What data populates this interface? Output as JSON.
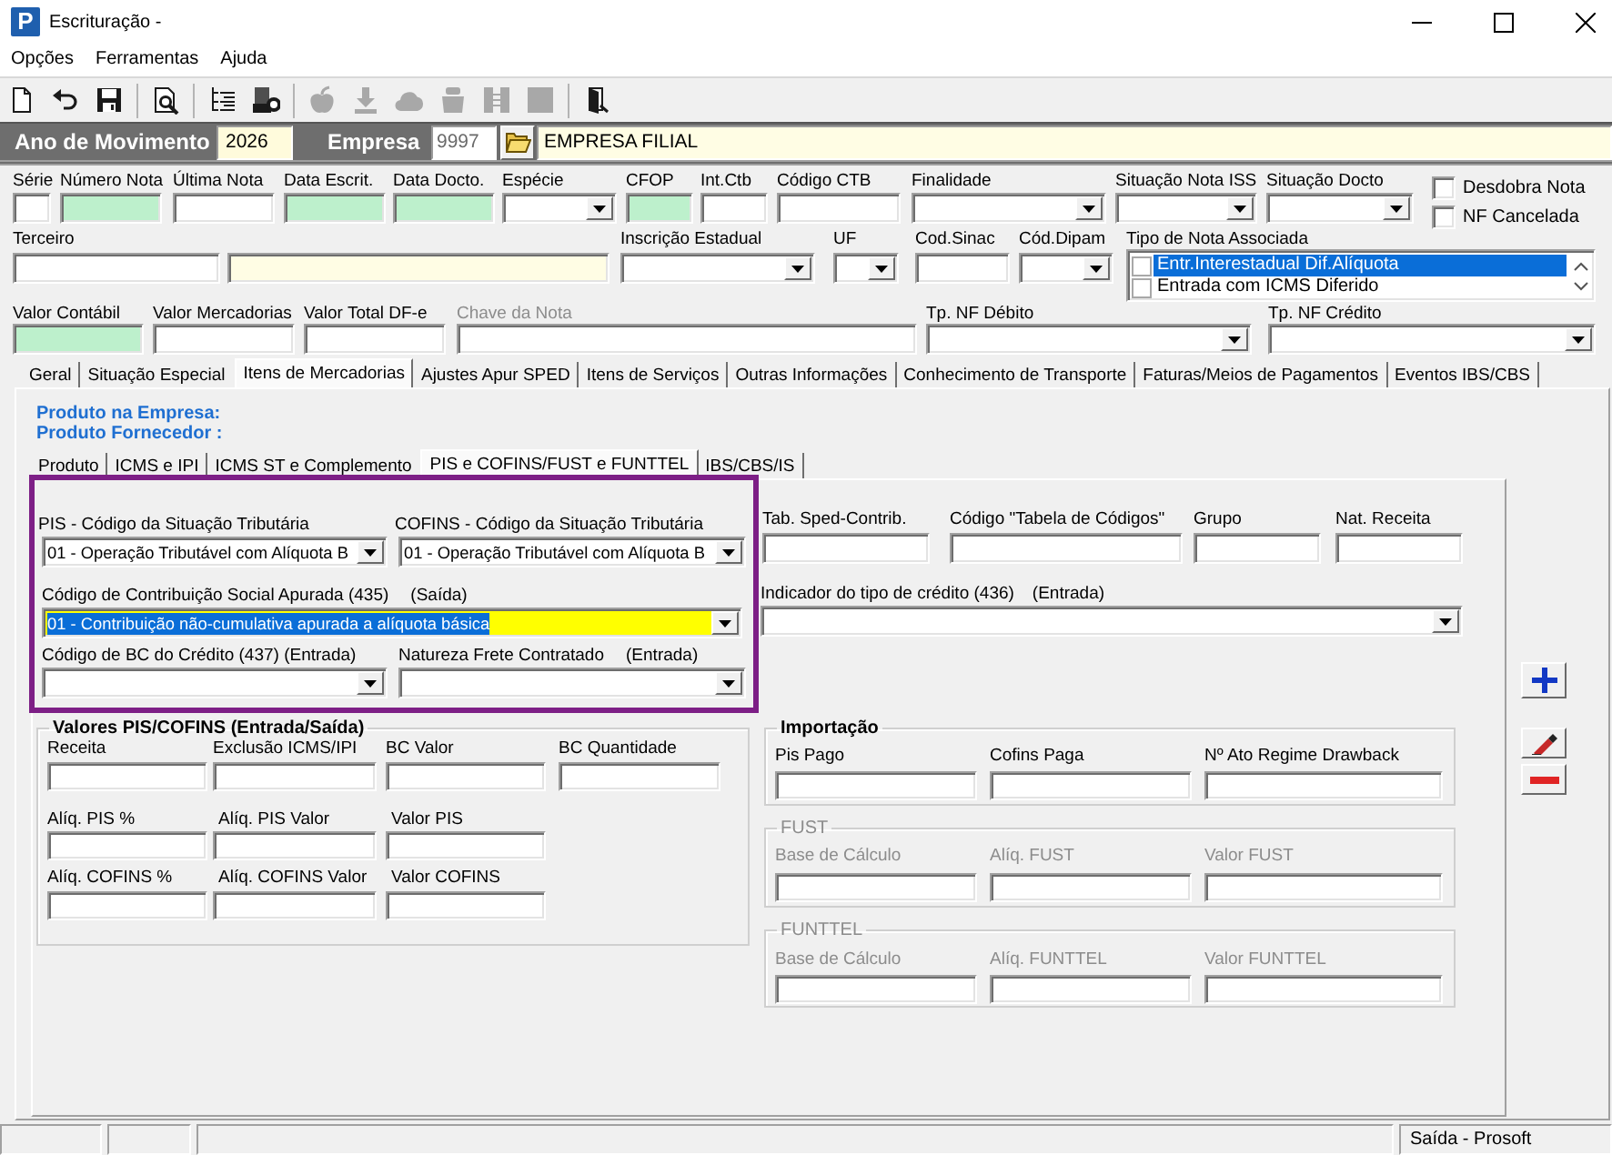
{
  "window": {
    "logo": "P",
    "title": "Escrituração -"
  },
  "menu": [
    {
      "label": "Opções"
    },
    {
      "label": "Ferramentas"
    },
    {
      "label": "Ajuda"
    }
  ],
  "toolbar": [
    {
      "items": [
        {
          "disabled": false
        },
        {
          "disabled": false
        },
        {
          "disabled": false
        }
      ]
    },
    {
      "items": [
        {
          "disabled": false
        }
      ]
    },
    {
      "items": [
        {
          "disabled": false
        },
        {
          "disabled": false
        }
      ]
    },
    {
      "items": [
        {
          "disabled": true
        },
        {
          "disabled": true
        },
        {
          "disabled": true
        },
        {
          "disabled": true
        },
        {
          "disabled": true
        },
        {
          "disabled": true
        }
      ]
    },
    {
      "items": [
        {
          "disabled": false
        }
      ]
    }
  ],
  "header": {
    "year_label": "Ano de Movimento",
    "year": "2026",
    "company_label": "Empresa",
    "company_code": "9997",
    "company_name": "EMPRESA FILIAL"
  },
  "form": {
    "row_1": [
      {
        "label": "Série",
        "kind": "text",
        "highlighted": false
      },
      {
        "label": "Número Nota",
        "kind": "text",
        "highlighted": true
      },
      {
        "label": "Última Nota",
        "kind": "text",
        "highlighted": false
      },
      {
        "label": "Data Escrit.",
        "kind": "text",
        "highlighted": true
      },
      {
        "label": "Data Docto.",
        "kind": "text",
        "highlighted": true
      },
      {
        "label": "Espécie",
        "kind": "select",
        "highlighted": false
      },
      {
        "label": "CFOP",
        "kind": "text",
        "highlighted": true
      },
      {
        "label": "Int.Ctb",
        "kind": "text",
        "highlighted": false
      },
      {
        "label": "Código CTB",
        "kind": "text",
        "highlighted": false
      },
      {
        "label": "Finalidade",
        "kind": "select",
        "highlighted": false
      },
      {
        "label": "Situação Nota ISS",
        "kind": "select",
        "highlighted": false
      },
      {
        "label": "Situação Docto",
        "kind": "select",
        "highlighted": false
      }
    ],
    "options": [
      {
        "label": "Desdobra Nota",
        "checked": false
      },
      {
        "label": "NF Cancelada",
        "checked": false
      }
    ],
    "row_2": [
      {
        "label": "Terceiro",
        "kind": "text"
      },
      {
        "kind": "display"
      },
      {
        "label": "Inscrição Estadual",
        "kind": "select"
      },
      {
        "label": "UF",
        "kind": "select"
      },
      {
        "label": "Cod.Sinac",
        "kind": "text"
      },
      {
        "label": "Cód.Dipam",
        "kind": "select"
      },
      {
        "label": "Tipo de Nota Associada",
        "kind": "checklist",
        "items": [
          {
            "label": "Entr.Interestadual Dif.Alíquota",
            "checked": false,
            "selected": true
          },
          {
            "label": "Entrada com ICMS Diferido",
            "checked": false,
            "selected": false
          }
        ]
      }
    ],
    "row_3": [
      {
        "label": "Valor Contábil",
        "kind": "text",
        "highlighted": true,
        "disabled": false
      },
      {
        "label": "Valor Mercadorias",
        "kind": "text",
        "highlighted": false,
        "disabled": false
      },
      {
        "label": "Valor Total DF-e",
        "kind": "text",
        "highlighted": false,
        "disabled": false
      },
      {
        "label": "Chave da Nota",
        "kind": "text",
        "highlighted": false,
        "disabled": true
      },
      {
        "label": "Tp. NF Débito",
        "kind": "select",
        "highlighted": false,
        "disabled": false
      },
      {
        "label": "Tp. NF Crédito",
        "kind": "select",
        "highlighted": false,
        "disabled": false
      }
    ]
  },
  "tabs": [
    {
      "label": "Geral",
      "selected": false
    },
    {
      "label": "Situação Especial",
      "selected": false
    },
    {
      "label": "Itens de Mercadorias",
      "selected": true
    },
    {
      "label": "Ajustes Apur SPED",
      "selected": false
    },
    {
      "label": "Itens de Serviços",
      "selected": false
    },
    {
      "label": "Outras Informações",
      "selected": false
    },
    {
      "label": "Conhecimento de Transporte",
      "selected": false
    },
    {
      "label": "Faturas/Meios de Pagamentos",
      "selected": false
    },
    {
      "label": "Eventos IBS/CBS",
      "selected": false
    }
  ],
  "product": [
    "Produto na Empresa:",
    "Produto Fornecedor :"
  ],
  "subtabs": [
    {
      "label": "Produto",
      "selected": false
    },
    {
      "label": "ICMS e IPI",
      "selected": false
    },
    {
      "label": "ICMS ST e Complemento",
      "selected": false
    },
    {
      "label": "PIS e COFINS/FUST e FUNTTEL",
      "selected": true
    },
    {
      "label": "IBS/CBS/IS",
      "selected": false
    }
  ],
  "pis_cofins": {
    "cst": [
      {
        "label": "PIS - Código da Situação Tributária",
        "value": "01 - Operação Tributável com Alíquota B"
      },
      {
        "label": "COFINS - Código da Situação Tributária",
        "value": "01 - Operação Tributável com Alíquota B"
      }
    ],
    "codes": [
      {
        "label": "Tab. Sped-Contrib."
      },
      {
        "label": "Código \"Tabela de Códigos\""
      },
      {
        "label": "Grupo"
      },
      {
        "label": "Nat. Receita"
      }
    ],
    "contribution": {
      "label": "Código de Contribuição Social Apurada (435)",
      "direction": "(Saída)",
      "value": "01 - Contribuição não-cumulativa apurada a alíquota básica",
      "focused": true
    },
    "credit_type": {
      "label": "Indicador do tipo de crédito (436)",
      "direction": "(Entrada)",
      "focused": false
    },
    "credit": [
      {
        "label": "Código de BC do Crédito (437) (Entrada)"
      },
      {
        "label": "Natureza Frete Contratado",
        "direction": "(Entrada)"
      }
    ]
  },
  "values": {
    "title": "Valores PIS/COFINS (Entrada/Saída)",
    "rows": [
      {
        "fields": [
          {
            "label": "Receita"
          },
          {
            "label": "Exclusão ICMS/IPI"
          },
          {
            "label": "BC Valor"
          },
          {
            "label": "BC Quantidade"
          }
        ]
      },
      {
        "fields": [
          {
            "label": "Alíq. PIS %"
          },
          {
            "label": "Alíq. PIS Valor"
          },
          {
            "label": "Valor PIS"
          }
        ]
      },
      {
        "fields": [
          {
            "label": "Alíq. COFINS %"
          },
          {
            "label": "Alíq. COFINS Valor"
          },
          {
            "label": "Valor COFINS"
          }
        ]
      }
    ]
  },
  "groups": [
    {
      "title": "Importação",
      "disabled": false,
      "fields": [
        {
          "label": "Pis Pago"
        },
        {
          "label": "Cofins Paga"
        },
        {
          "label": "Nº Ato Regime Drawback"
        }
      ]
    },
    {
      "title": "FUST",
      "disabled": true,
      "fields": [
        {
          "label": "Base de Cálculo"
        },
        {
          "label": "Alíq. FUST"
        },
        {
          "label": "Valor FUST"
        }
      ]
    },
    {
      "title": "FUNTTEL",
      "disabled": true,
      "fields": [
        {
          "label": "Base de Cálculo"
        },
        {
          "label": "Alíq. FUNTTEL"
        },
        {
          "label": "Valor FUNTTEL"
        }
      ]
    }
  ],
  "status_bar": {
    "text": "Saída - Prosoft"
  }
}
